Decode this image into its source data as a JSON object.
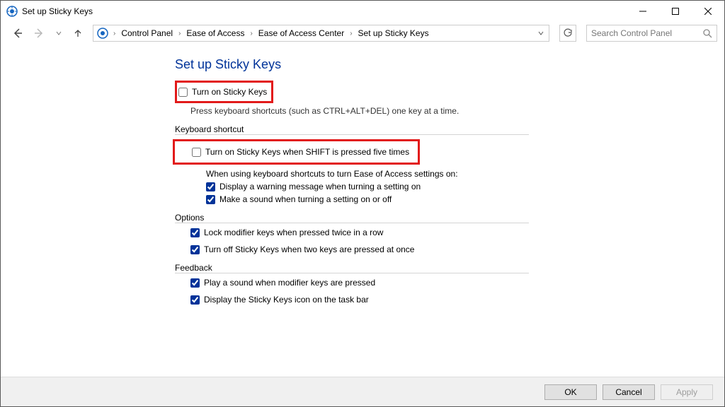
{
  "title": "Set up Sticky Keys",
  "breadcrumb": {
    "items": [
      "Control Panel",
      "Ease of Access",
      "Ease of Access Center",
      "Set up Sticky Keys"
    ]
  },
  "search": {
    "placeholder": "Search Control Panel"
  },
  "page": {
    "heading": "Set up Sticky Keys",
    "main_check": "Turn on Sticky Keys",
    "main_desc": "Press keyboard shortcuts (such as CTRL+ALT+DEL) one key at a time.",
    "section_shortcut": "Keyboard shortcut",
    "shortcut_check": "Turn on Sticky Keys when SHIFT is pressed five times",
    "shortcut_note": "When using keyboard shortcuts to turn Ease of Access settings on:",
    "shortcut_warn": "Display a warning message when turning a setting on",
    "shortcut_sound": "Make a sound when turning a setting on or off",
    "section_options": "Options",
    "opt_lock": "Lock modifier keys when pressed twice in a row",
    "opt_turnoff": "Turn off Sticky Keys when two keys are pressed at once",
    "section_feedback": "Feedback",
    "fb_sound": "Play a sound when modifier keys are pressed",
    "fb_icon": "Display the Sticky Keys icon on the task bar"
  },
  "buttons": {
    "ok": "OK",
    "cancel": "Cancel",
    "apply": "Apply"
  }
}
